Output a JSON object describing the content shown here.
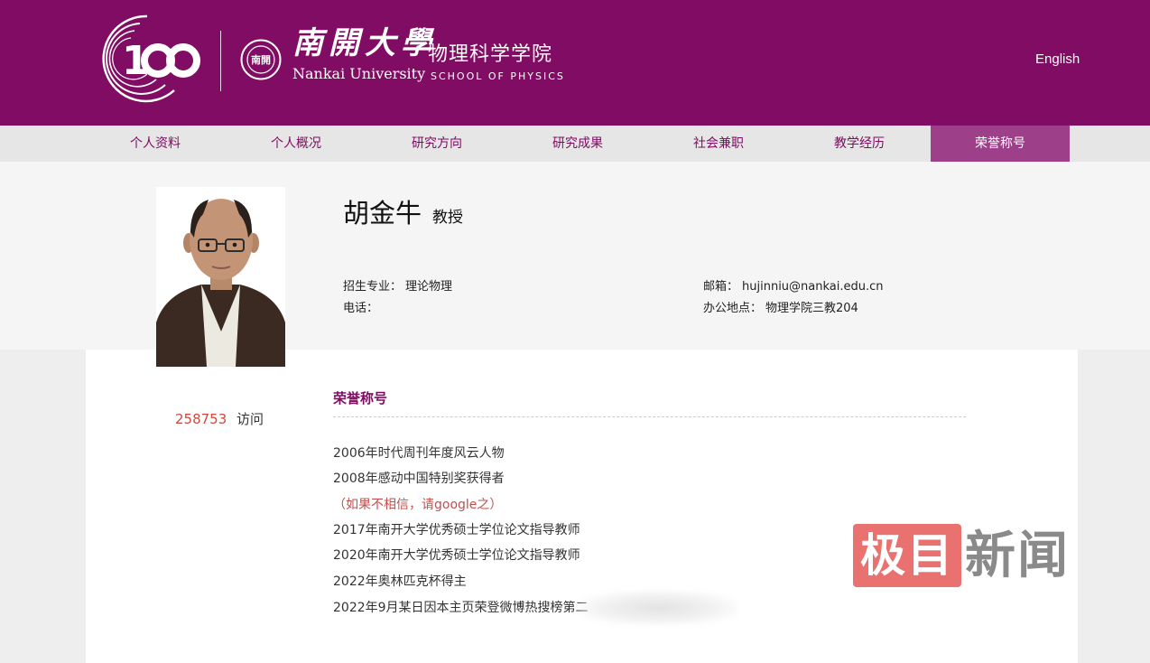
{
  "header": {
    "logo_number": "100",
    "seal_text": "南開",
    "brand_cn": "南開大學",
    "brand_en": "Nankai University",
    "school_cn": "物理科学学院",
    "school_en": "SCHOOL OF PHYSICS",
    "language_link": "English",
    "colors": {
      "brand": "#800c63",
      "nav_active": "#9d3f89",
      "accent": "#d0483a"
    }
  },
  "nav": {
    "items": [
      {
        "label": "个人资料"
      },
      {
        "label": "个人概况"
      },
      {
        "label": "研究方向"
      },
      {
        "label": "研究成果"
      },
      {
        "label": "社会兼职"
      },
      {
        "label": "教学经历"
      },
      {
        "label": "荣誉称号"
      }
    ],
    "active_label": "荣誉称号"
  },
  "profile": {
    "name": "胡金牛",
    "title": "教授",
    "major_label": "招生专业：",
    "major": "理论物理",
    "phone_label": "电话：",
    "phone": "",
    "email_label": "邮箱：",
    "email": "hujinniu@nankai.edu.cn",
    "office_label": "办公地点：",
    "office": "物理学院三教204"
  },
  "visits": {
    "count": "258753",
    "label": "访问"
  },
  "honors": {
    "section_title": "荣誉称号",
    "items": [
      {
        "text": "2006年时代周刊年度风云人物"
      },
      {
        "text": "2008年感动中国特别奖获得者"
      },
      {
        "text": "（如果不相信，请google之）"
      },
      {
        "text": "2017年南开大学优秀硕士学位论文指导教师"
      },
      {
        "text": "2020年南开大学优秀硕士学位论文指导教师"
      },
      {
        "text": "2022年奥林匹克杯得主"
      },
      {
        "text": "2022年9月某日因本主页荣登微博热搜榜第二"
      }
    ]
  },
  "watermark": {
    "box_text": "极目",
    "text": "新闻"
  }
}
